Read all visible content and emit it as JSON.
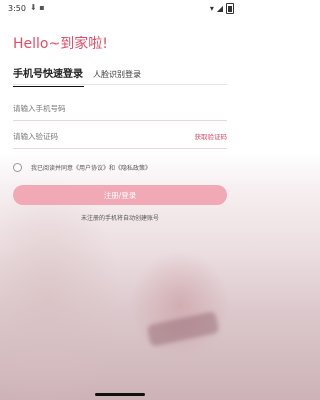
{
  "status_bar": {
    "time": "3:50",
    "left_icons": "⬇ ▪",
    "wifi_icon": "wifi-icon",
    "signal_icon": "signal-icon",
    "battery_icon": "battery-icon"
  },
  "greeting": "Hello~到家啦!",
  "tabs": [
    {
      "label": "手机号快速登录",
      "active": true
    },
    {
      "label": "人脸识别登录",
      "active": false
    }
  ],
  "phone": {
    "placeholder": "请输入手机号码",
    "value": ""
  },
  "code": {
    "placeholder": "请输入验证码",
    "value": "",
    "get_code_label": "获取验证码"
  },
  "agreement": {
    "prefix": "我已阅读并同意",
    "user_agreement": "《用户协议》",
    "and": "和",
    "privacy_policy": "《隐私政策》"
  },
  "submit_label": "注册/登录",
  "hint": "未注册的手机将自动创建账号",
  "colors": {
    "accent": "#e24d68",
    "button": "#f0a9b5"
  }
}
